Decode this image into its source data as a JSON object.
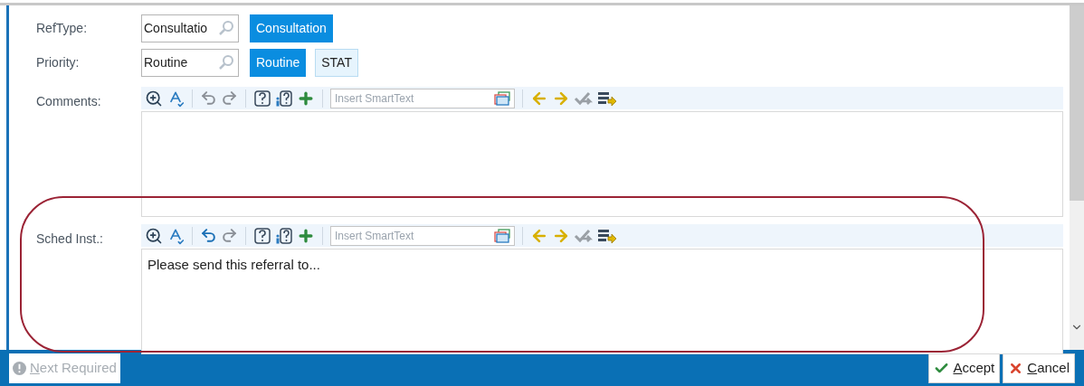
{
  "fields": [
    {
      "label": "RefType:",
      "kind": "lookup",
      "value": "Consultatio",
      "options": [
        {
          "label": "Consultation",
          "selected": true
        }
      ]
    },
    {
      "label": "Priority:",
      "kind": "lookup",
      "value": "Routine",
      "options": [
        {
          "label": "Routine",
          "selected": true
        },
        {
          "label": "STAT",
          "selected": false
        }
      ]
    },
    {
      "label": "Comments:",
      "kind": "text",
      "smarttext_placeholder": "Insert SmartText",
      "undo_enabled": false,
      "highlighted": false
    },
    {
      "label": "Sched Inst.:",
      "kind": "text",
      "smarttext_placeholder": "Insert SmartText",
      "undo_enabled": true,
      "highlighted": true,
      "value": "Please send this referral to..."
    }
  ],
  "footer": {
    "next_required": {
      "hotkey": "N",
      "rest": "ext Required",
      "disabled": true
    },
    "actions": [
      {
        "kind": "accept",
        "hotkey": "A",
        "rest": "ccept"
      },
      {
        "kind": "cancel",
        "hotkey": "C",
        "rest": "ancel"
      }
    ]
  }
}
